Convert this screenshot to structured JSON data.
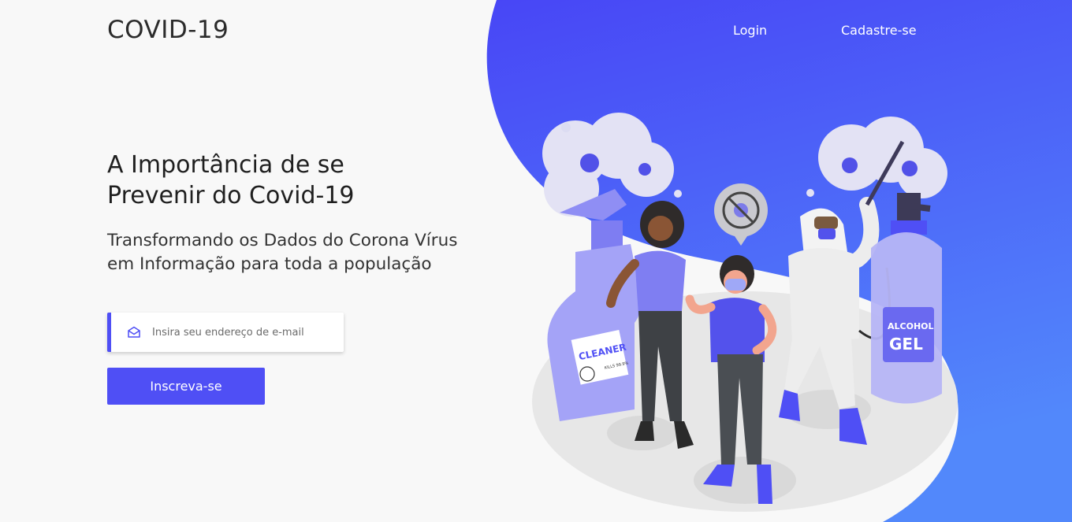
{
  "header": {
    "logo": "COVID-19",
    "nav": [
      {
        "label": "Login"
      },
      {
        "label": "Cadastre-se"
      }
    ]
  },
  "hero": {
    "headline": "A Importância de se Prevenir do Covid-19",
    "subtitle": "Transformando os Dados do Corona Vírus em Informação para toda a população",
    "email_placeholder": "Insira seu endereço de e-mail",
    "email_value": "",
    "subscribe_label": "Inscreva-se"
  },
  "illustration": {
    "cleaner_label": "CLEANER",
    "cleaner_small": "KILLS 99.9%",
    "bottle_label_1": "ALCOHOL",
    "bottle_label_2": "GEL"
  },
  "colors": {
    "accent": "#4f4ff5",
    "blob_top": "#4b4af6",
    "blob_bottom": "#5185fb",
    "background": "#f8f8f8"
  }
}
